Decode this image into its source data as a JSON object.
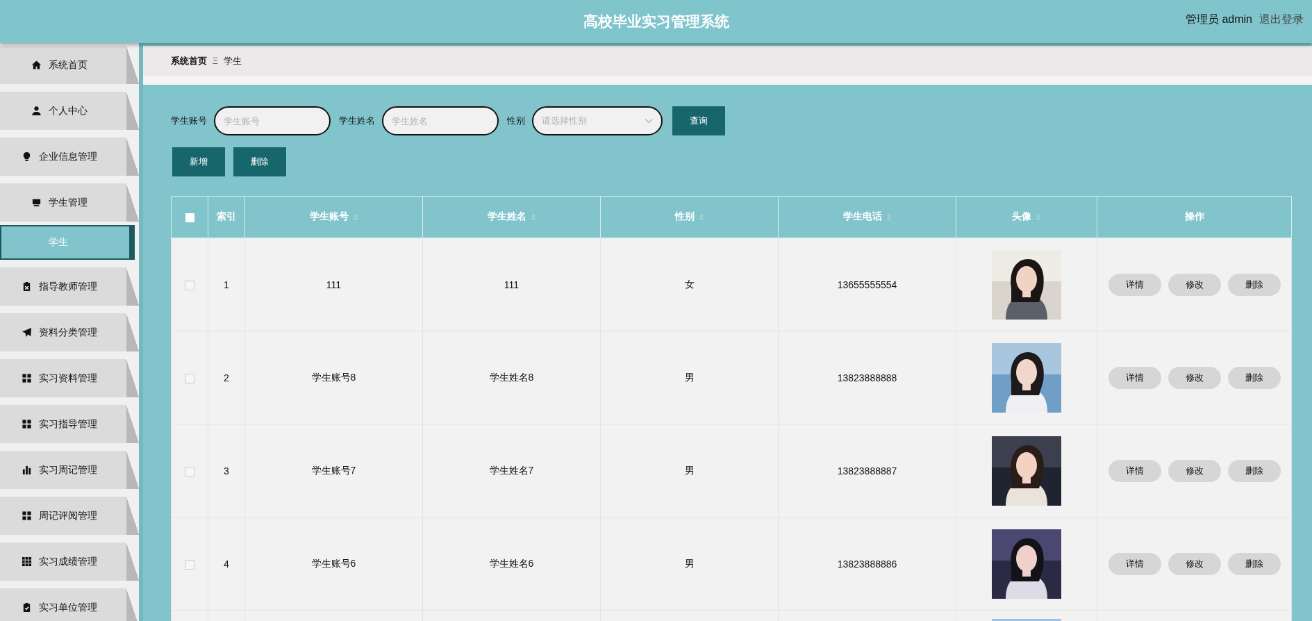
{
  "header": {
    "title": "高校毕业实习管理系统",
    "user": "管理员 admin",
    "logout": "退出登录"
  },
  "sidebar": {
    "items": [
      {
        "label": "系统首页",
        "selected": false
      },
      {
        "label": "个人中心",
        "selected": false
      },
      {
        "label": "企业信息管理",
        "selected": false
      },
      {
        "label": "学生管理",
        "selected": false,
        "children": [
          {
            "label": "学生",
            "selected": true
          }
        ]
      },
      {
        "label": "指导教师管理",
        "selected": false
      },
      {
        "label": "资料分类管理",
        "selected": false
      },
      {
        "label": "实习资料管理",
        "selected": false
      },
      {
        "label": "实习指导管理",
        "selected": false
      },
      {
        "label": "实习周记管理",
        "selected": false
      },
      {
        "label": "周记评阅管理",
        "selected": false
      },
      {
        "label": "实习成绩管理",
        "selected": false
      },
      {
        "label": "实习单位管理",
        "selected": false
      }
    ]
  },
  "breadcrumb": {
    "home": "系统首页",
    "separator": "Ξ",
    "current": "学生"
  },
  "search": {
    "fields": [
      {
        "kind": "text",
        "label": "学生账号",
        "placeholder": "学生账号"
      },
      {
        "kind": "text",
        "label": "学生姓名",
        "placeholder": "学生姓名"
      },
      {
        "kind": "select",
        "label": "性别",
        "placeholder": "请选择性别"
      }
    ],
    "button": "查询"
  },
  "actions": [
    "新增",
    "删除"
  ],
  "table": {
    "header_checked": false,
    "columns": [
      {
        "label": "索引",
        "sortable": false
      },
      {
        "label": "学生账号",
        "sortable": true
      },
      {
        "label": "学生姓名",
        "sortable": true
      },
      {
        "label": "性别",
        "sortable": true
      },
      {
        "label": "学生电话",
        "sortable": true
      },
      {
        "label": "头像",
        "sortable": true
      },
      {
        "label": "操作",
        "sortable": false
      }
    ],
    "rows": [
      {
        "checked": false,
        "index": "1",
        "account": "111",
        "name": "111",
        "gender": "女",
        "phone": "13655555554",
        "avatar": {
          "kind": "picture"
        },
        "buttons": [
          "详情",
          "修改",
          "删除"
        ]
      },
      {
        "checked": false,
        "index": "2",
        "account": "学生账号8",
        "name": "学生姓名8",
        "gender": "男",
        "phone": "13823888888",
        "avatar": {
          "kind": "picture"
        },
        "buttons": [
          "详情",
          "修改",
          "删除"
        ]
      },
      {
        "checked": false,
        "index": "3",
        "account": "学生账号7",
        "name": "学生姓名7",
        "gender": "男",
        "phone": "13823888887",
        "avatar": {
          "kind": "picture"
        },
        "buttons": [
          "详情",
          "修改",
          "删除"
        ]
      },
      {
        "checked": false,
        "index": "4",
        "account": "学生账号6",
        "name": "学生姓名6",
        "gender": "男",
        "phone": "13823888886",
        "avatar": {
          "kind": "picture"
        },
        "buttons": [
          "详情",
          "修改",
          "删除"
        ]
      }
    ]
  }
}
